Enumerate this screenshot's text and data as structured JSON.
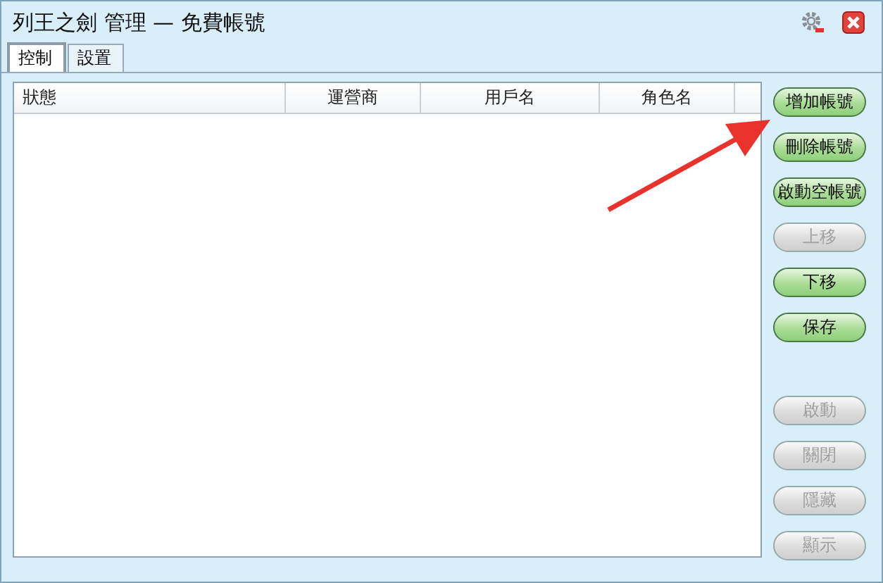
{
  "window": {
    "title": "列王之劍 管理 — 免費帳號"
  },
  "tabs": [
    {
      "label": "控制",
      "selected": true
    },
    {
      "label": "設置",
      "selected": false
    }
  ],
  "table": {
    "columns": [
      {
        "label": "狀態"
      },
      {
        "label": "運營商"
      },
      {
        "label": "用戶名"
      },
      {
        "label": "角色名"
      }
    ]
  },
  "button_groups": [
    [
      {
        "label": "增加帳號",
        "disabled": false
      },
      {
        "label": "刪除帳號",
        "disabled": false
      },
      {
        "label": "啟動空帳號",
        "disabled": false
      },
      {
        "label": "上移",
        "disabled": true
      },
      {
        "label": "下移",
        "disabled": false
      },
      {
        "label": "保存",
        "disabled": false
      }
    ],
    [
      {
        "label": "啟動",
        "disabled": true
      },
      {
        "label": "關閉",
        "disabled": true
      },
      {
        "label": "隱藏",
        "disabled": true
      },
      {
        "label": "顯示",
        "disabled": true
      }
    ]
  ]
}
